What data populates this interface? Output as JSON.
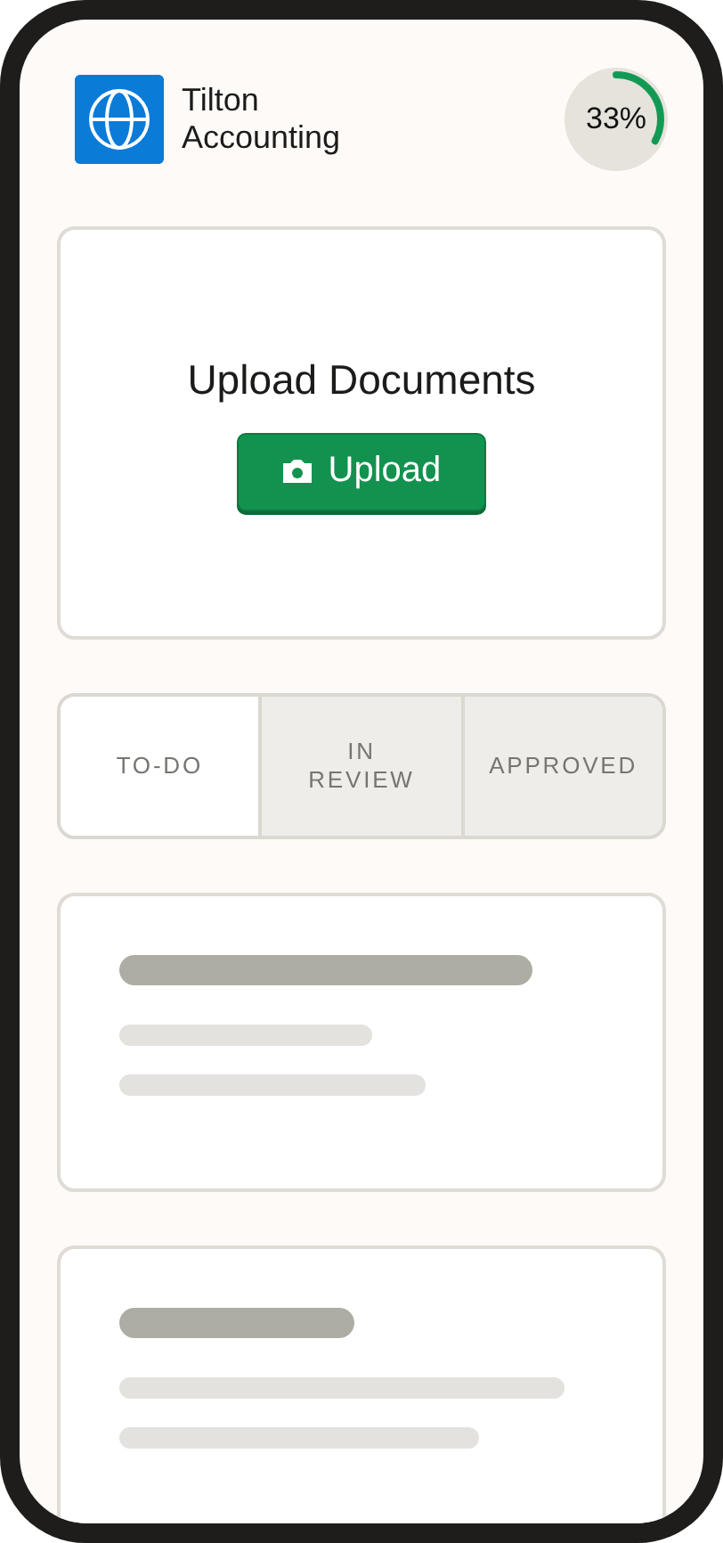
{
  "header": {
    "company": "Tilton Accounting",
    "progress": {
      "level": 0.33,
      "reading": "33%"
    }
  },
  "upload_card": {
    "title": "Upload Documents",
    "button": "Upload"
  },
  "tabs": [
    {
      "label": "TO-DO",
      "selected": true
    },
    {
      "label": "IN REVIEW",
      "selected": false
    },
    {
      "label": "APPROVED",
      "selected": false
    }
  ],
  "task_cards": [
    {
      "kind": "skeleton"
    },
    {
      "kind": "skeleton"
    }
  ]
}
